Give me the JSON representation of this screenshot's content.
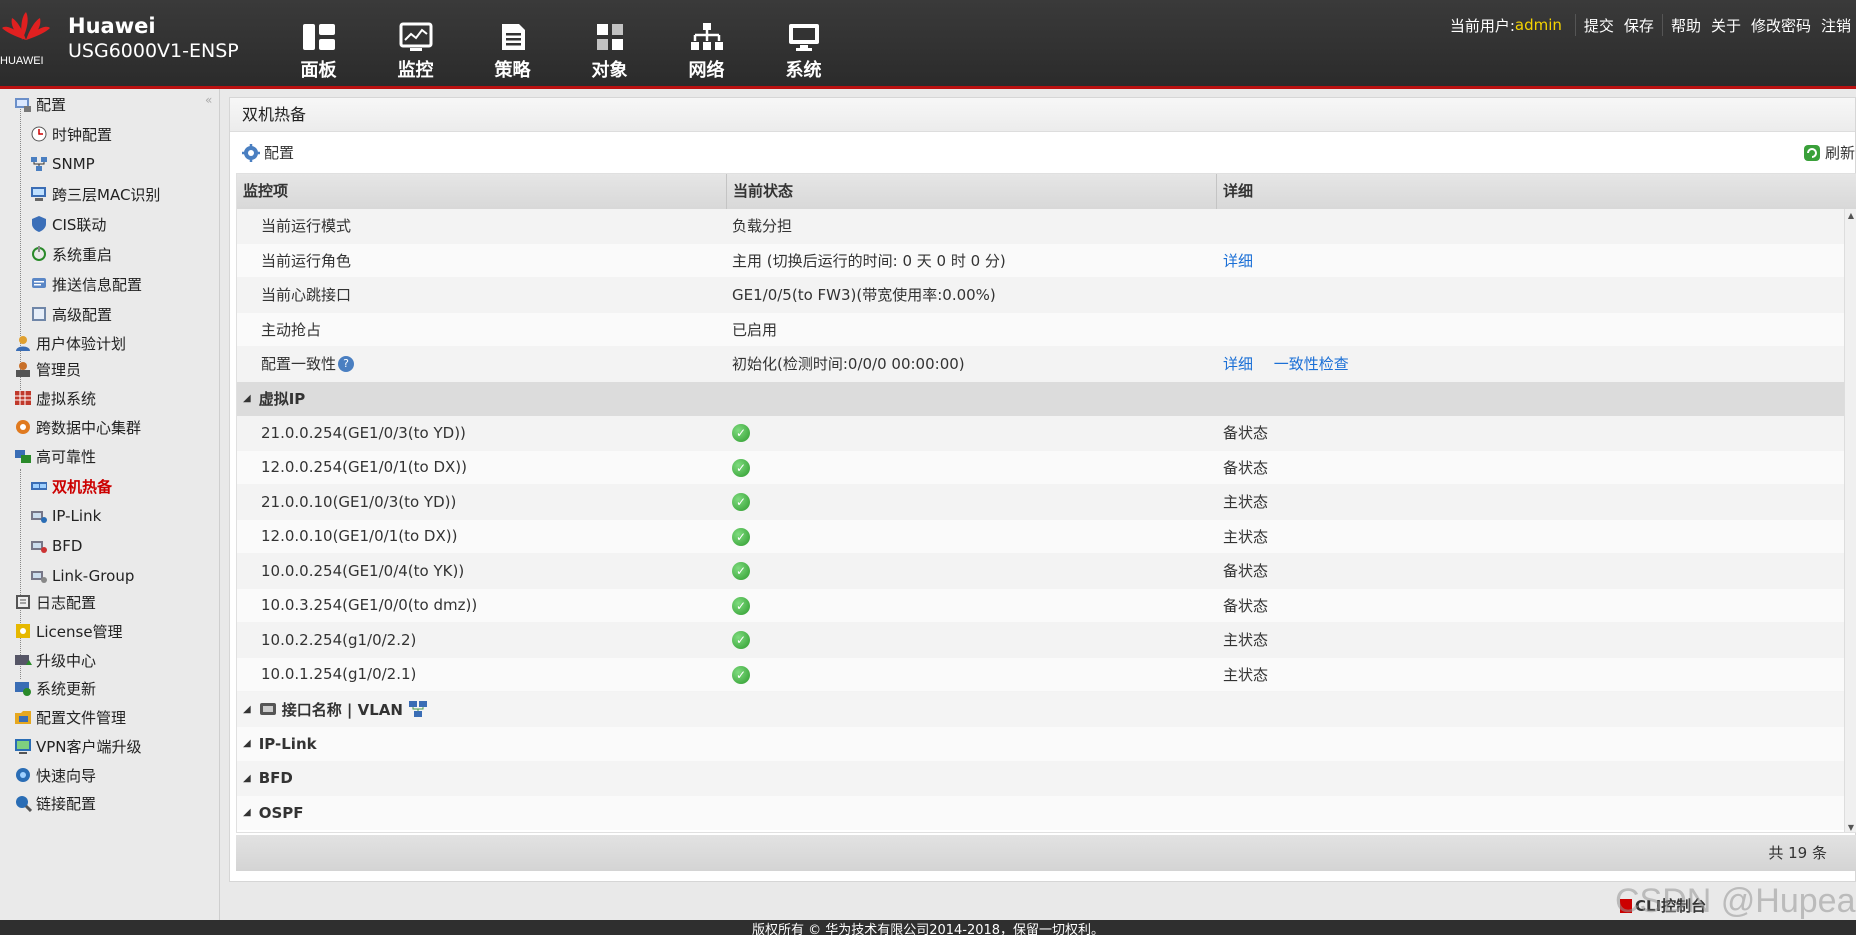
{
  "header": {
    "brand_name": "Huawei",
    "model": "USG6000V1-ENSP",
    "logo_text": "HUAWEI",
    "nav": [
      {
        "label": "面板",
        "icon": "dashboard-icon"
      },
      {
        "label": "监控",
        "icon": "monitor-icon"
      },
      {
        "label": "策略",
        "icon": "policy-icon"
      },
      {
        "label": "对象",
        "icon": "object-icon"
      },
      {
        "label": "网络",
        "icon": "network-icon"
      },
      {
        "label": "系统",
        "icon": "system-icon"
      }
    ],
    "user_label": "当前用户:",
    "user_name": "admin",
    "actions": [
      "提交",
      "保存",
      "帮助",
      "关于",
      "修改密码",
      "注销"
    ]
  },
  "sidebar": {
    "items": [
      {
        "label": "配置",
        "icon": "config-icon"
      },
      {
        "label": "时钟配置",
        "icon": "clock-icon"
      },
      {
        "label": "SNMP",
        "icon": "snmp-icon"
      },
      {
        "label": "跨三层MAC识别",
        "icon": "mac-icon"
      },
      {
        "label": "CIS联动",
        "icon": "cis-icon"
      },
      {
        "label": "系统重启",
        "icon": "restart-icon"
      },
      {
        "label": "推送信息配置",
        "icon": "push-icon"
      },
      {
        "label": "高级配置",
        "icon": "advanced-icon"
      },
      {
        "label": "用户体验计划",
        "icon": "user-experience-icon"
      },
      {
        "label": "管理员",
        "icon": "admin-icon"
      },
      {
        "label": "虚拟系统",
        "icon": "virtual-system-icon"
      },
      {
        "label": "跨数据中心集群",
        "icon": "cluster-icon"
      },
      {
        "label": "高可靠性",
        "icon": "high-availability-icon"
      },
      {
        "label": "双机热备",
        "icon": "hot-standby-icon"
      },
      {
        "label": "IP-Link",
        "icon": "ip-link-icon"
      },
      {
        "label": "BFD",
        "icon": "bfd-icon"
      },
      {
        "label": "Link-Group",
        "icon": "link-group-icon"
      },
      {
        "label": "日志配置",
        "icon": "log-icon"
      },
      {
        "label": "License管理",
        "icon": "license-icon"
      },
      {
        "label": "升级中心",
        "icon": "upgrade-icon"
      },
      {
        "label": "系统更新",
        "icon": "update-icon"
      },
      {
        "label": "配置文件管理",
        "icon": "config-file-icon"
      },
      {
        "label": "VPN客户端升级",
        "icon": "vpn-icon"
      },
      {
        "label": "快速向导",
        "icon": "wizard-icon"
      },
      {
        "label": "链接配置",
        "icon": "link-config-icon"
      }
    ]
  },
  "panel": {
    "title": "双机热备",
    "config_label": "配置",
    "refresh_label": "刷新",
    "columns": [
      "监控项",
      "当前状态",
      "详细"
    ],
    "status_rows": [
      {
        "item": "当前运行模式",
        "status": "负载分担",
        "links": []
      },
      {
        "item": "当前运行角色",
        "status": "主用 (切换后运行的时间: 0 天 0 时 0 分)",
        "links": [
          "详细"
        ]
      },
      {
        "item": "当前心跳接口",
        "status": "GE1/0/5(to FW3)(带宽使用率:0.00%)",
        "links": []
      },
      {
        "item": "主动抢占",
        "status": "已启用",
        "links": []
      },
      {
        "item": "配置一致性",
        "status": "初始化(检测时间:0/0/0 00:00:00)",
        "links": [
          "详细",
          "一致性检查"
        ]
      }
    ],
    "vip_group": "虚拟IP",
    "vip_rows": [
      {
        "ip": "21.0.0.254(GE1/0/3(to YD))",
        "state": "备状态"
      },
      {
        "ip": "12.0.0.254(GE1/0/1(to DX))",
        "state": "备状态"
      },
      {
        "ip": "21.0.0.10(GE1/0/3(to YD))",
        "state": "主状态"
      },
      {
        "ip": "12.0.0.10(GE1/0/1(to DX))",
        "state": "主状态"
      },
      {
        "ip": "10.0.0.254(GE1/0/4(to YK))",
        "state": "备状态"
      },
      {
        "ip": "10.0.3.254(GE1/0/0(to dmz))",
        "state": "备状态"
      },
      {
        "ip": "10.0.2.254(g1/0/2.2)",
        "state": "主状态"
      },
      {
        "ip": "10.0.1.254(g1/0/2.1)",
        "state": "主状态"
      }
    ],
    "groups": [
      "接口名称 | VLAN",
      "IP-Link",
      "BFD",
      "OSPF"
    ],
    "total": "共 19 条"
  },
  "bottom": {
    "cli_label": "CLI控制台",
    "watermark": "CSDN @Hupea",
    "copyright": "版权所有 © 华为技术有限公司2014-2018，保留一切权利。"
  },
  "colors": {
    "header_bg": "#2f2f2f",
    "user_name": "#f5d400",
    "active_item": "#cc0000",
    "link": "#1a6fd6",
    "ok": "#2d9a2d"
  }
}
